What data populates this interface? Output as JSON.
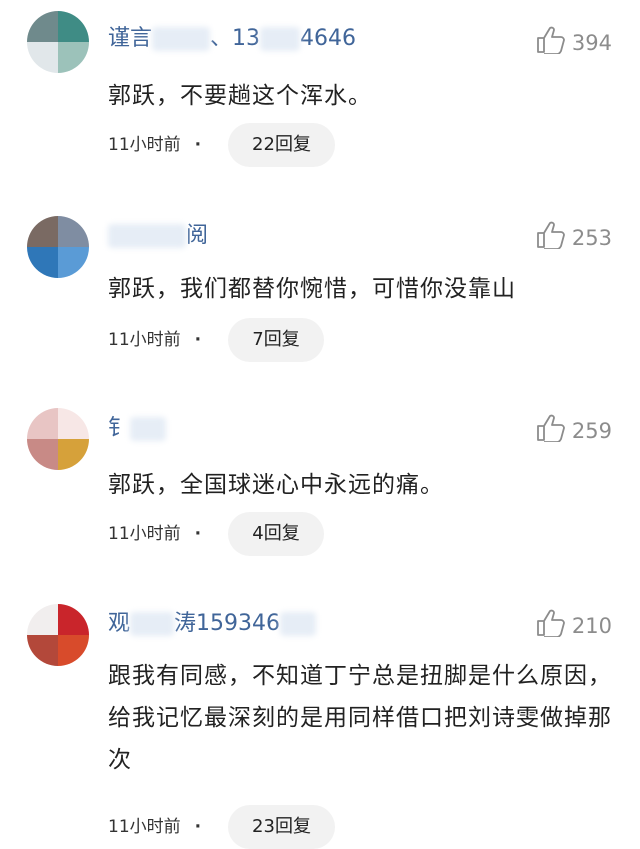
{
  "comments": [
    {
      "username_left": "谨言",
      "username_right": "、13",
      "username_tail": "4646",
      "likes": "394",
      "text": "郭跃，不要趟这个浑水。",
      "time": "11小时前",
      "replies": "22回复",
      "avatar_colors": [
        "#6f8a8c",
        "#3f8c85",
        "#e1e7ea",
        "#9cc2ba"
      ]
    },
    {
      "username_left": "",
      "username_right": "",
      "username_tail": "阅",
      "likes": "253",
      "text": "郭跃，我们都替你惋惜，可惜你没靠山",
      "time": "11小时前",
      "replies": "7回复",
      "avatar_colors": [
        "#7a6a63",
        "#7f8da2",
        "#2f77b8",
        "#5a9bd6"
      ]
    },
    {
      "username_left": "钅",
      "username_right": "",
      "username_tail": "",
      "likes": "259",
      "text": "郭跃，全国球迷心中永远的痛。",
      "time": "11小时前",
      "replies": "4回复",
      "avatar_colors": [
        "#e8c5c4",
        "#f7e7e6",
        "#c88a86",
        "#d6a13a"
      ]
    },
    {
      "username_left": "观",
      "username_right": "涛159346",
      "username_tail": "",
      "likes": "210",
      "text": "跟我有同感，不知道丁宁总是扭脚是什么原因，给我记忆最深刻的是用同样借口把刘诗雯做掉那次",
      "time": "11小时前",
      "replies": "23回复",
      "avatar_colors": [
        "#f1eeee",
        "#c9252b",
        "#b3483a",
        "#d84b2b"
      ]
    }
  ],
  "meta_dot": "·"
}
